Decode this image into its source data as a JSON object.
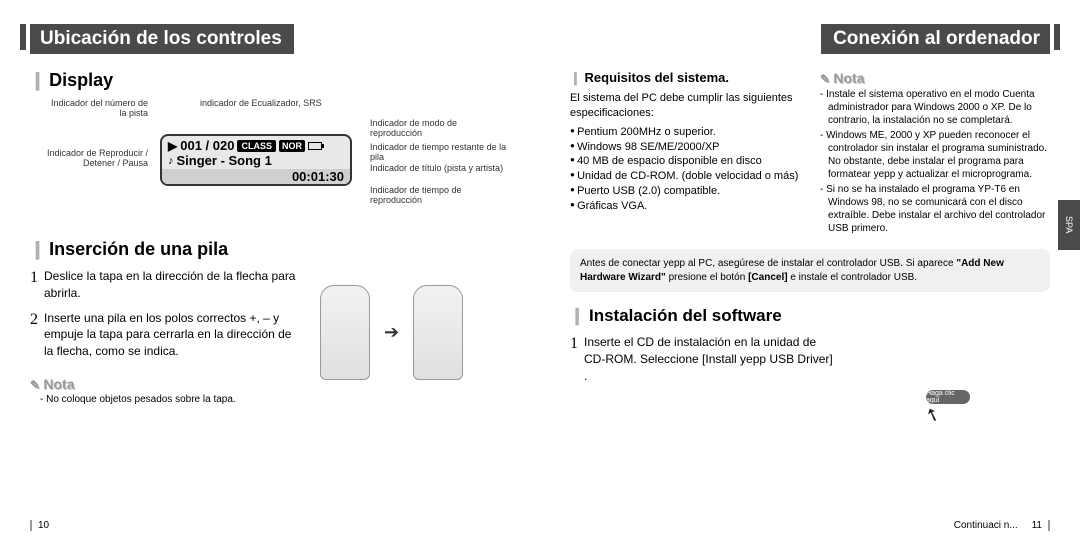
{
  "left": {
    "header": "Ubicación de los controles",
    "display_title": "Display",
    "callouts": {
      "track_indicator": "Indicador del\nnúmero de la pista",
      "eq_indicator": "indicador de Ecualizador, SRS",
      "play_mode": "Indicador de modo de reproducción",
      "play_status": "Indicador de Reproducir\n/ Detener / Pausa",
      "battery_remain": "Indicador de tiempo restante de la pila",
      "title_indicator": "Indicador de título (pista y artista)",
      "play_time": "Indicador de tiempo de reproducción"
    },
    "lcd": {
      "track": "001 / 020",
      "class_label": "CLASS",
      "nor_label": "NOR",
      "song": "Singer - Song 1",
      "time": "00:01:30"
    },
    "battery_title": "Inserción de una pila",
    "steps": {
      "s1": "Deslice la tapa en la dirección de la flecha para abrirla.",
      "s2": "Inserte una pila en los polos correctos +, – y empuje la tapa para cerrarla en la dirección de la flecha, como se indica."
    },
    "nota_label": "Nota",
    "nota_text": "No coloque objetos pesados sobre la tapa.",
    "page_num": "10"
  },
  "right": {
    "header": "Conexión al ordenador",
    "req_title": "Requisitos del sistema.",
    "req_intro": "El sistema del PC debe cumplir las siguientes especificaciones:",
    "req_items": {
      "r1": "Pentium 200MHz o superior.",
      "r2": "Windows 98 SE/ME/2000/XP",
      "r3": "40 MB de espacio disponible en disco",
      "r4": "Unidad de CD-ROM. (doble velocidad o más)",
      "r5": "Puerto USB (2.0) compatible.",
      "r6": "Gráficas VGA."
    },
    "nota_label": "Nota",
    "nota_items": {
      "n1": "Instale el sistema operativo en el modo Cuenta administrador para Windows 2000 o XP. De lo contrario, la instalación no se completará.",
      "n2": "Windows ME, 2000 y XP pueden reconocer el controlador sin instalar el programa suministrado. No obstante, debe instalar el programa para formatear yepp y actualizar el microprograma.",
      "n3": "Si no se ha instalado el programa YP-T6 en Windows 98, no se comunicará con el disco extraíble. Debe instalar el archivo del controlador USB primero."
    },
    "info_box_pre": "Antes de conectar yepp al PC, asegúrese de instalar el controlador USB. Si aparece",
    "info_box_bold": "\"Add New Hardware Wizard\"",
    "info_box_mid": " presione el botón ",
    "info_box_bold2": "[Cancel]",
    "info_box_post": " e instale el controlador USB.",
    "install_title": "Instalación del software",
    "install_step1": "Inserte el CD de instalación en la unidad de CD-ROM. Seleccione [Install yepp USB Driver] .",
    "click_here": "Haga clic aquí",
    "side_tab": "SPA",
    "footer_text": "Continuaci n...",
    "page_num": "11"
  }
}
